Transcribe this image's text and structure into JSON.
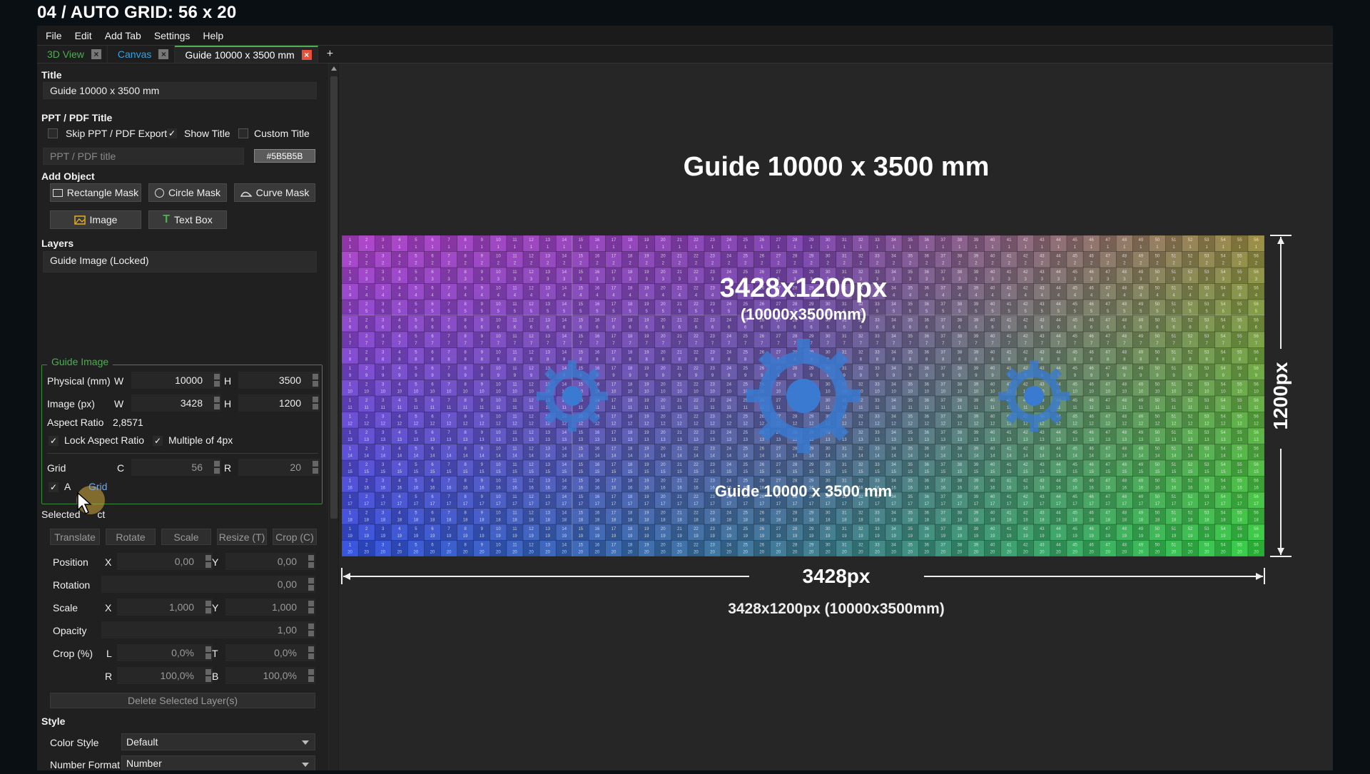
{
  "video_title": "04 / AUTO GRID: 56 x 20",
  "menu": [
    "File",
    "Edit",
    "Add Tab",
    "Settings",
    "Help"
  ],
  "tabs": [
    {
      "label": "3D View",
      "color": "#4caf50"
    },
    {
      "label": "Canvas",
      "color": "#3aa0e0"
    },
    {
      "label": "Guide 10000 x 3500 mm",
      "color": "#ffffff"
    }
  ],
  "tab_add": "+",
  "panel": {
    "title_section": "Title",
    "title_value": "Guide 10000 x 3500 mm",
    "ppt_section": "PPT / PDF Title",
    "skip_ppt": "Skip PPT / PDF Export",
    "show_title": "Show Title",
    "custom_title": "Custom Title",
    "ppt_placeholder": "PPT / PDF title",
    "ppt_color": "#5B5B5B",
    "add_object_section": "Add Object",
    "btn_rect": "Rectangle Mask",
    "btn_circle": "Circle Mask",
    "btn_curve": "Curve Mask",
    "btn_image": "Image",
    "btn_textbox": "Text Box",
    "layers_section": "Layers",
    "layer_item": "Guide Image (Locked)",
    "guide_group": "Guide Image",
    "physical_label": "Physical (mm)",
    "image_label": "Image (px)",
    "w": "W",
    "h": "H",
    "physical_w": "10000",
    "physical_h": "3500",
    "image_w": "3428",
    "image_h": "1200",
    "aspect_label": "Aspect Ratio",
    "aspect_value": "2,8571",
    "lock_aspect": "Lock Aspect Ratio",
    "multiple4": "Multiple of 4px",
    "grid_label": "Grid",
    "c": "C",
    "r": "R",
    "grid_c": "56",
    "grid_r": "20",
    "auto_grid_a": "A",
    "auto_grid_b": "Grid",
    "selected_a": "Selected ",
    "selected_b": "ct",
    "translate": "Translate",
    "rotate": "Rotate",
    "scale": "Scale",
    "resize": "Resize (T)",
    "crop": "Crop (C)",
    "position_label": "Position",
    "x": "X",
    "y": "Y",
    "pos_x": "0,00",
    "pos_y": "0,00",
    "rotation_label": "Rotation",
    "rotation": "0,00",
    "scale_label": "Scale",
    "scale_x": "1,000",
    "scale_y": "1,000",
    "opacity_label": "Opacity",
    "opacity": "1,00",
    "crop_label": "Crop (%)",
    "l": "L",
    "t": "T",
    "rr": "R",
    "b": "B",
    "crop_l": "0,0%",
    "crop_t": "0,0%",
    "crop_r": "100,0%",
    "crop_b": "100,0%",
    "delete": "Delete Selected Layer(s)",
    "style_section": "Style",
    "color_style_label": "Color Style",
    "color_style": "Default",
    "number_format_label": "Number Format",
    "number_format": "Number"
  },
  "canvas": {
    "heading": "Guide 10000 x 3500 mm",
    "center_px": "3428x1200px",
    "center_mm": "(10000x3500mm)",
    "inner_label": "Guide 10000 x 3500 mm",
    "width_dim": "3428px",
    "height_dim": "1200px",
    "footer": "3428x1200px (10000x3500mm)",
    "cols": 56,
    "rows": 20
  }
}
